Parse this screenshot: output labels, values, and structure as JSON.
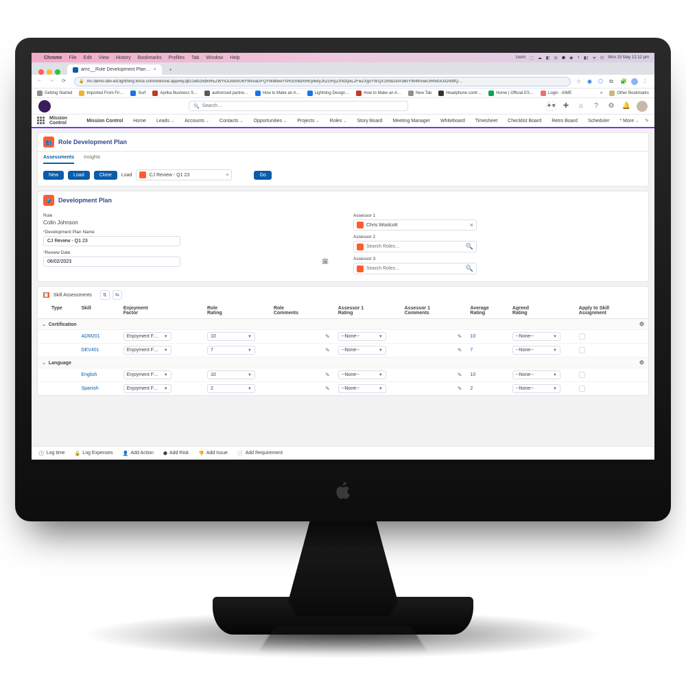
{
  "menubar": {
    "app": "Chrome",
    "items": [
      "File",
      "Edit",
      "View",
      "History",
      "Bookmarks",
      "Profiles",
      "Tab",
      "Window",
      "Help"
    ],
    "right_label_zoom": "zoom",
    "datetime": "Mon 15 May 12:12 pm"
  },
  "browser": {
    "tab_title": "amc__Role Development Plan…",
    "url": "mc-demo-dev-ed.lightning.force.com/one/one.app#eyJjb21wb25lbnREZWYiOiJvbmU6YWxvaGFQYWdlIiwiYXR0cmlidXRlcyI6eyJhZGRyZXNzIjoiL2FwZXgvYW1jX19Sb2xlX3BsYW4ifSwic3RhdGUiOnt9fQ…",
    "bookmarks": [
      {
        "label": "Getting Started",
        "color": "#8f8f8f"
      },
      {
        "label": "Imported From Fir…",
        "color": "#f0b429"
      },
      {
        "label": "Surf",
        "color": "#1a73e8"
      },
      {
        "label": "Aprika Business S…",
        "color": "#c0392b"
      },
      {
        "label": "authorised partne…",
        "color": "#5a5a5a"
      },
      {
        "label": "How to Make an A…",
        "color": "#1a73e8"
      },
      {
        "label": "Lightning Design…",
        "color": "#1a73e8"
      },
      {
        "label": "How to Make an A…",
        "color": "#c0392b"
      },
      {
        "label": "New Tab",
        "color": "#8f8f8f"
      },
      {
        "label": "Headphone contr…",
        "color": "#333"
      },
      {
        "label": "Home | Official ES…",
        "color": "#00a651"
      },
      {
        "label": "Login · AIME",
        "color": "#e57373"
      }
    ],
    "other_bookmarks": "Other Bookmarks"
  },
  "sf": {
    "search_placeholder": "Search…",
    "app_name": "Mission Control",
    "nav": [
      "Mission Control",
      "Home",
      "Leads",
      "Accounts",
      "Contacts",
      "Opportunities",
      "Projects",
      "Roles",
      "Story Board",
      "Meeting Manager",
      "Whiteboard",
      "Timesheet",
      "Checklist Board",
      "Retro Board",
      "Scheduler"
    ],
    "nav_more": "* More"
  },
  "page": {
    "title": "Role Development Plan",
    "tabs": [
      "Assessments",
      "Insights"
    ],
    "buttons": {
      "new": "New",
      "load": "Load",
      "clone": "Clone",
      "go": "Go"
    },
    "load_label": "Load",
    "load_lookup": "CJ Review - Q1 23",
    "dev_plan": {
      "section": "Development Plan",
      "role_label": "Role",
      "role_value": "Colin Johnson",
      "name_label": "Development Plan Name",
      "name_value": "CJ Review - Q1 23",
      "review_label": "Review Date",
      "review_value": "06/02/2023",
      "assessor1_label": "Assessor 1",
      "assessor1_value": "Chris Woolcott",
      "assessor2_label": "Assessor 2",
      "assessor3_label": "Assessor 3",
      "search_placeholder": "Search Roles…"
    },
    "skills": {
      "section": "Skill Assessments",
      "headers": {
        "type": "Type",
        "skill": "Skill",
        "enj1": "Enjoyment",
        "enj2": "Factor",
        "rr1": "Role",
        "rr2": "Rating",
        "rc1": "Role",
        "rc2": "Comments",
        "a1r1": "Assessor 1",
        "a1r2": "Rating",
        "a1c1": "Assessor 1",
        "a1c2": "Comments",
        "avg1": "Average",
        "avg2": "Rating",
        "agr1": "Agreed",
        "agr2": "Rating",
        "app1": "Apply to Skill",
        "app2": "Assignment"
      },
      "groups": [
        {
          "name": "Certification",
          "rows": [
            {
              "skill": "ADM201",
              "enj": "Enjoyment F…",
              "role_rating": "10",
              "a1_rating": "--None--",
              "avg": "10",
              "agreed": "--None--"
            },
            {
              "skill": "DEV401",
              "enj": "Enjoyment F…",
              "role_rating": "7",
              "a1_rating": "--None--",
              "avg": "7",
              "agreed": "--None--"
            }
          ]
        },
        {
          "name": "Language",
          "rows": [
            {
              "skill": "English",
              "enj": "Enjoyment F…",
              "role_rating": "10",
              "a1_rating": "--None--",
              "avg": "10",
              "agreed": "--None--"
            },
            {
              "skill": "Spanish",
              "enj": "Enjoyment F…",
              "role_rating": "2",
              "a1_rating": "--None--",
              "avg": "2",
              "agreed": "--None--"
            }
          ]
        }
      ]
    },
    "utility": [
      "Log time",
      "Log Expenses",
      "Add Action",
      "Add Risk",
      "Add Issue",
      "Add Requirement"
    ]
  }
}
